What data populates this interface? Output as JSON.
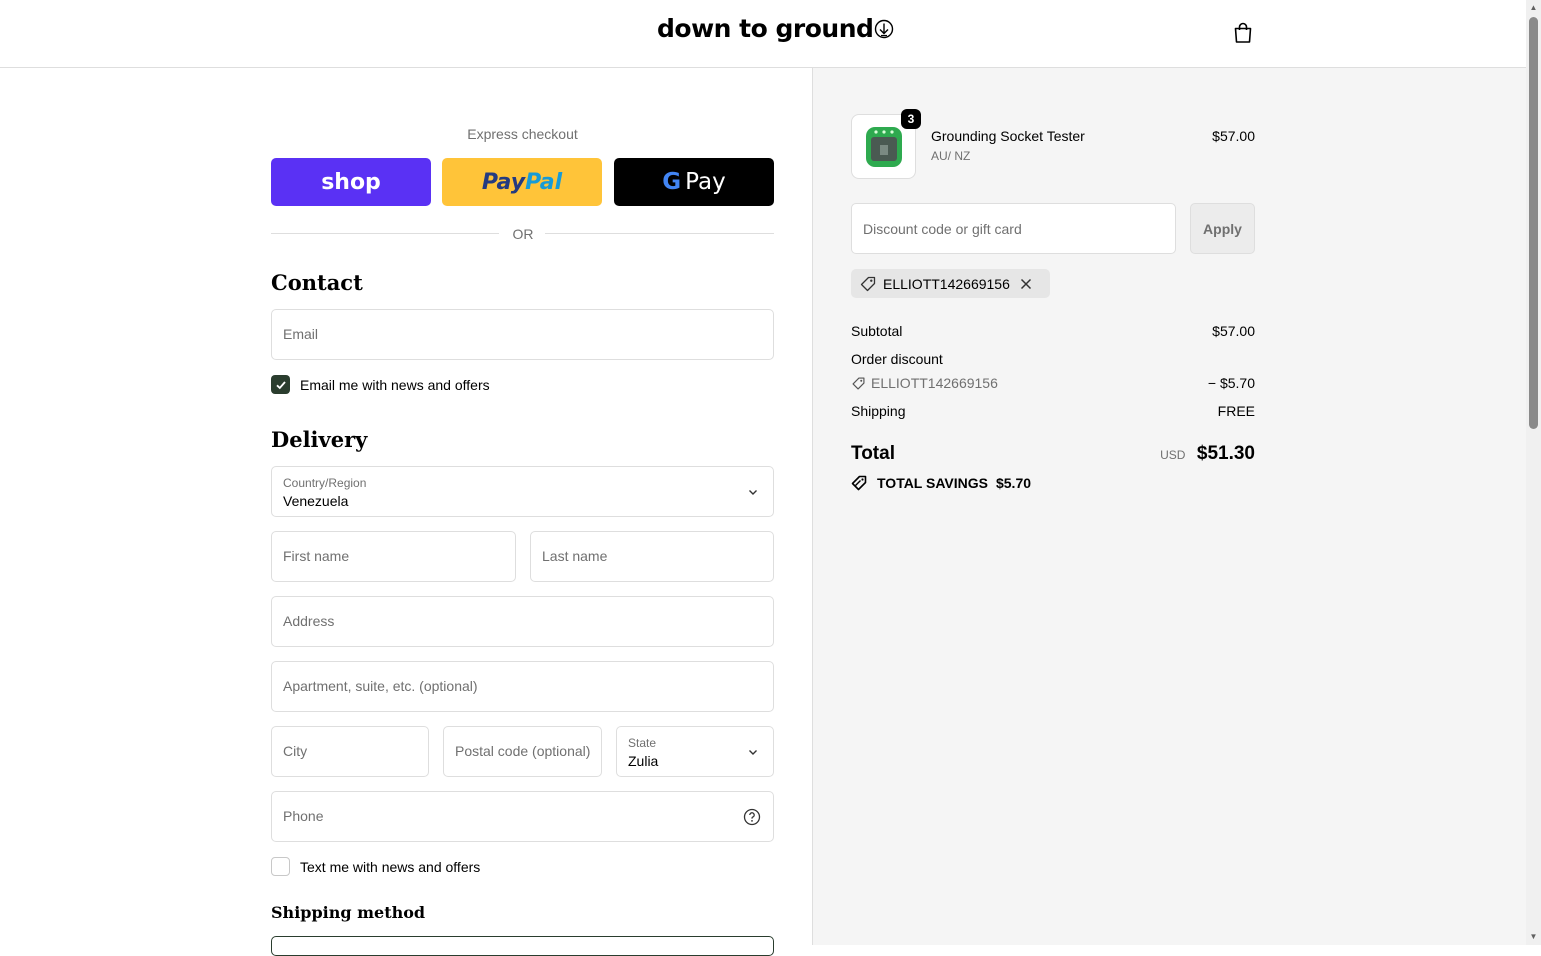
{
  "header": {
    "logo_text": "down to ground"
  },
  "express": {
    "label": "Express checkout",
    "shop_label": "shop",
    "paypal_part1": "Pay",
    "paypal_part2": "Pal",
    "gpay_g": "G",
    "gpay_label": "Pay",
    "or_text": "OR"
  },
  "contact": {
    "heading": "Contact",
    "email_placeholder": "Email",
    "newsletter_label": "Email me with news and offers",
    "newsletter_checked": true
  },
  "delivery": {
    "heading": "Delivery",
    "country_label": "Country/Region",
    "country_value": "Venezuela",
    "first_name_placeholder": "First name",
    "last_name_placeholder": "Last name",
    "address_placeholder": "Address",
    "apartment_placeholder": "Apartment, suite, etc. (optional)",
    "city_placeholder": "City",
    "postal_placeholder": "Postal code (optional)",
    "state_label": "State",
    "state_value": "Zulia",
    "phone_placeholder": "Phone",
    "sms_label": "Text me with news and offers",
    "sms_checked": false
  },
  "shipping": {
    "heading": "Shipping method"
  },
  "order": {
    "product": {
      "name": "Grounding Socket Tester",
      "variant": "AU/ NZ",
      "price": "$57.00",
      "quantity": "3"
    },
    "discount_placeholder": "Discount code or gift card",
    "apply_label": "Apply",
    "applied_code": "ELLIOTT142669156",
    "subtotal_label": "Subtotal",
    "subtotal_value": "$57.00",
    "order_discount_label": "Order discount",
    "discount_code": "ELLIOTT142669156",
    "discount_value": "− $5.70",
    "shipping_label": "Shipping",
    "shipping_value": "FREE",
    "total_label": "Total",
    "total_currency": "USD",
    "total_value": "$51.30",
    "savings_label": "TOTAL SAVINGS",
    "savings_value": "$5.70"
  },
  "colors": {
    "shop_purple": "#5a31f4",
    "paypal_yellow": "#ffc439",
    "checkbox_green": "#2a3d2e",
    "summary_bg": "#f5f5f5"
  }
}
